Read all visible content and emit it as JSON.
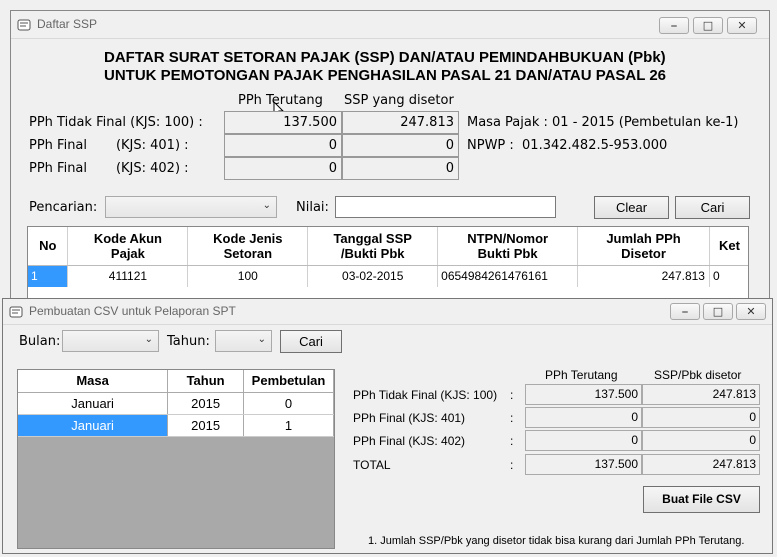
{
  "win1": {
    "title": "Daftar SSP",
    "heading1": "DAFTAR SURAT SETORAN PAJAK (SSP) DAN/ATAU PEMINDAHBUKUAN (Pbk)",
    "heading2": "UNTUK PEMOTONGAN PAJAK PENGHASILAN PASAL 21 DAN/ATAU PASAL 26",
    "col_pph": "PPh Terutang",
    "col_ssp": "SSP yang disetor",
    "rows": [
      {
        "label": "PPh Tidak Final (KJS: 100) :",
        "pph": "137.500",
        "ssp": "247.813"
      },
      {
        "label": "PPh Final       (KJS: 401) :",
        "pph": "0",
        "ssp": "0"
      },
      {
        "label": "PPh Final       (KJS: 402) :",
        "pph": "0",
        "ssp": "0"
      }
    ],
    "masa_pajak": "Masa Pajak : 01 - 2015 (Pembetulan ke-1)",
    "npwp": "NPWP :  01.342.482.5-953.000",
    "pencarian_label": "Pencarian:",
    "nilai_label": "Nilai:",
    "clear": "Clear",
    "cari": "Cari",
    "table_headers": [
      "No",
      "Kode Akun\nPajak",
      "Kode Jenis\nSetoran",
      "Tanggal SSP\n/Bukti Pbk",
      "NTPN/Nomor\nBukti Pbk",
      "Jumlah PPh\nDisetor",
      "Ket"
    ],
    "table_rows": [
      {
        "no": "1",
        "kode_akun": "411121",
        "kode_jenis": "100",
        "tanggal": "03-02-2015",
        "ntpn": "0654984261476161",
        "jumlah": "247.813",
        "ket": "0"
      }
    ]
  },
  "win2": {
    "title": "Pembuatan CSV untuk Pelaporan SPT",
    "bulan_label": "Bulan:",
    "tahun_label": "Tahun:",
    "cari": "Cari",
    "table_headers": [
      "Masa",
      "Tahun",
      "Pembetulan"
    ],
    "table_rows": [
      {
        "masa": "Januari",
        "tahun": "2015",
        "pembetulan": "0"
      },
      {
        "masa": "Januari",
        "tahun": "2015",
        "pembetulan": "1"
      }
    ],
    "col_pph": "PPh Terutang",
    "col_ssp": "SSP/Pbk disetor",
    "rows": [
      {
        "label": "PPh Tidak Final (KJS: 100)",
        "pph": "137.500",
        "ssp": "247.813"
      },
      {
        "label": "PPh Final (KJS: 401)",
        "pph": "0",
        "ssp": "0"
      },
      {
        "label": "PPh Final (KJS: 402)",
        "pph": "0",
        "ssp": "0"
      },
      {
        "label": "TOTAL",
        "pph": "137.500",
        "ssp": "247.813"
      }
    ],
    "colon": ":",
    "buat_file": "Buat File CSV",
    "note": "1. Jumlah SSP/Pbk yang disetor tidak bisa kurang dari Jumlah PPh Terutang."
  },
  "window_buttons": {
    "minimize": "▭",
    "maximize": "▢",
    "close": "✕"
  }
}
